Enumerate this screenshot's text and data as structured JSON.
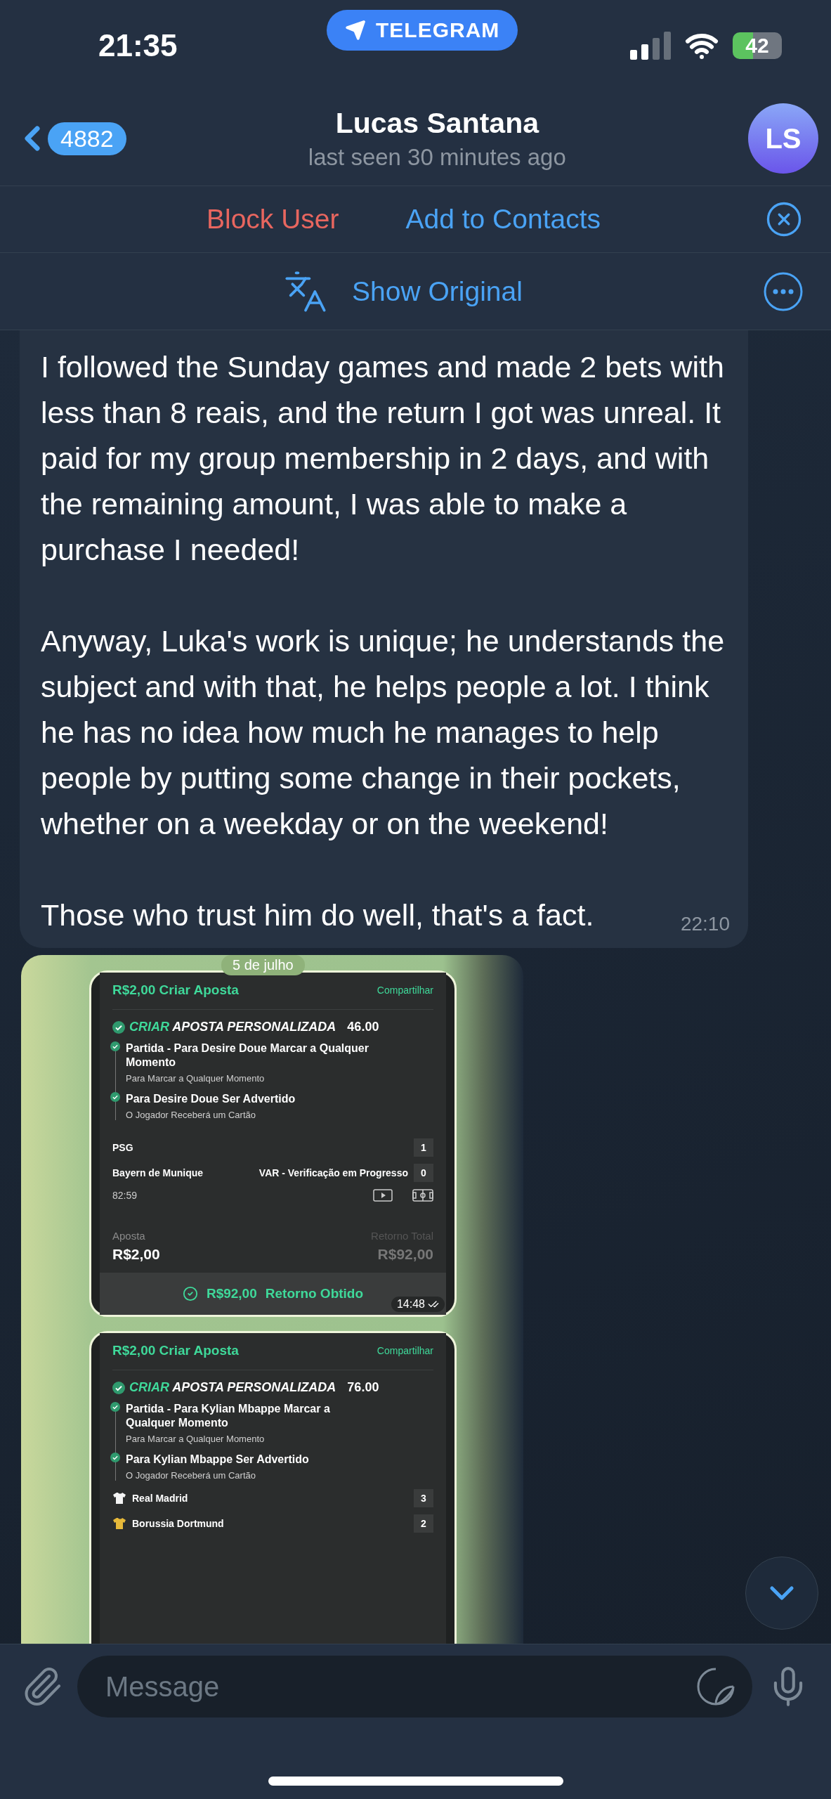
{
  "status_bar": {
    "time": "21:35",
    "app_pill": "TELEGRAM",
    "battery": "42"
  },
  "header": {
    "back_count": "4882",
    "name": "Lucas Santana",
    "status": "last seen 30 minutes ago",
    "avatar": "LS"
  },
  "action_bar": {
    "block": "Block User",
    "add": "Add to Contacts"
  },
  "translate_bar": {
    "label": "Show Original"
  },
  "message": {
    "paragraphs": [
      "I followed the Sunday games and made 2 bets with less than 8 reais, and the return I got was unreal. It paid for my group membership in 2 days, and with the remaining amount, I was able to make a purchase I needed!",
      "Anyway, Luka's work is unique; he understands the subject and with that, he helps people a lot. I think he has no idea how much he manages to help people by putting some change in their pockets, whether on a weekday or on the weekend!",
      "Those who trust him do well, that's a fact."
    ],
    "time": "22:10"
  },
  "photo": {
    "date": "5 de julho",
    "cards": [
      {
        "title": "R$2,00 Criar Aposta",
        "share": "Compartilhar",
        "heading_accent": "CRIAR",
        "heading": "APOSTA PERSONALIZADA",
        "odds": "46.00",
        "legs": [
          {
            "title": "Partida - Para Desire Doue Marcar a Qualquer Momento",
            "subtitle": "Para Marcar a Qualquer Momento"
          },
          {
            "title": "Para Desire Doue Ser Advertido",
            "subtitle": "O Jogador Receberá um Cartão"
          }
        ],
        "teams": [
          {
            "name": "PSG",
            "score": "1"
          },
          {
            "name": "Bayern de Munique",
            "note": "VAR - Verificação em Progresso",
            "score": "0"
          }
        ],
        "clock": "82:59",
        "stake_label": "Aposta",
        "stake": "R$2,00",
        "return_label": "Retorno Total",
        "return": "R$92,00",
        "result_amount": "R$92,00",
        "result_label": "Retorno Obtido",
        "time": "14:48"
      },
      {
        "title": "R$2,00 Criar Aposta",
        "share": "Compartilhar",
        "heading_accent": "CRIAR",
        "heading": "APOSTA PERSONALIZADA",
        "odds": "76.00",
        "legs": [
          {
            "title": "Partida - Para Kylian Mbappe Marcar a Qualquer Momento",
            "subtitle": "Para Marcar a Qualquer Momento"
          },
          {
            "title": "Para Kylian Mbappe Ser Advertido",
            "subtitle": "O Jogador Receberá um Cartão"
          }
        ],
        "teams": [
          {
            "name": "Real Madrid",
            "score": "3",
            "color": "#f4f4f4"
          },
          {
            "name": "Borussia Dortmund",
            "score": "2",
            "color": "#e7b93a"
          }
        ]
      }
    ]
  },
  "composer": {
    "placeholder": "Message"
  }
}
